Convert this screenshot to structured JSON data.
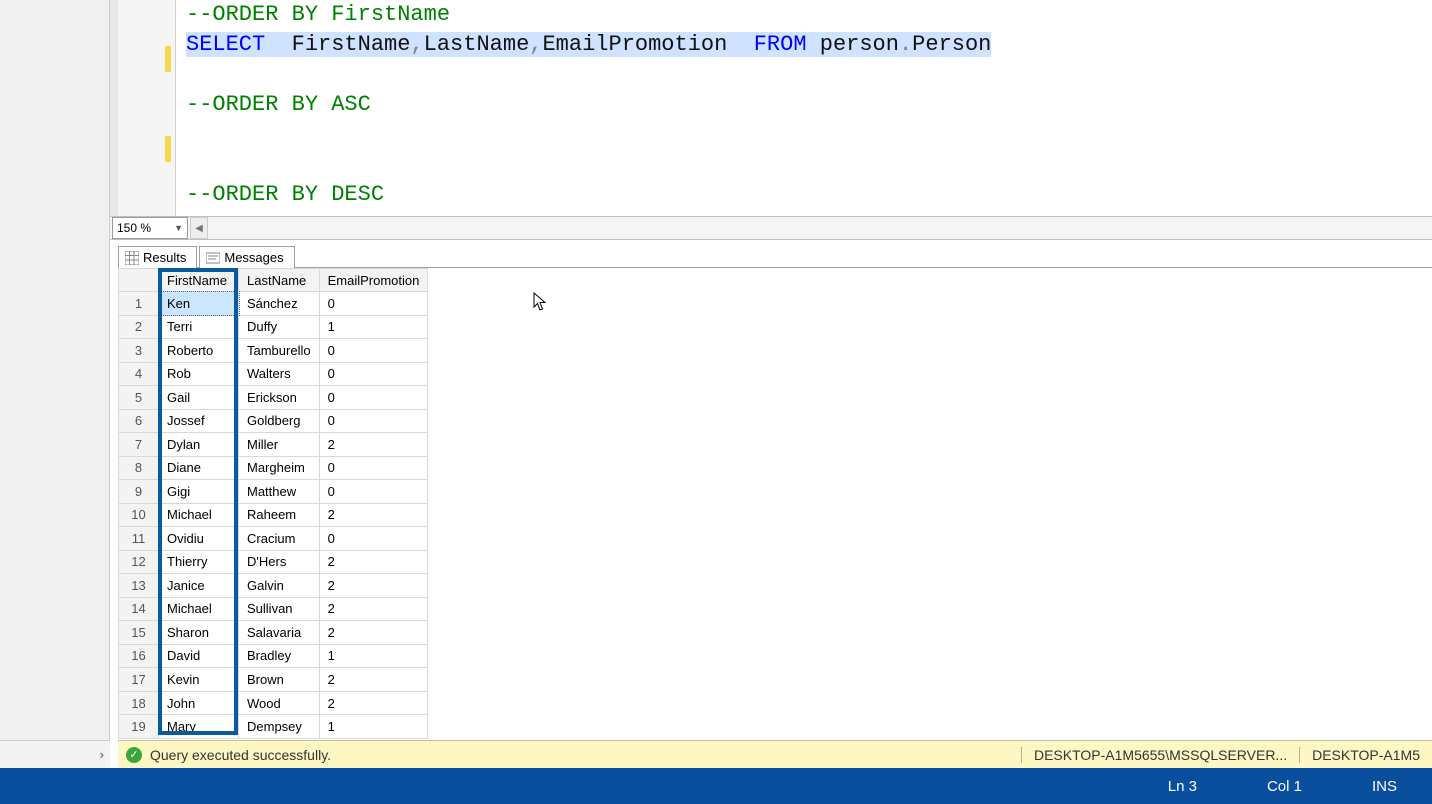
{
  "editor": {
    "comment1": "--ORDER BY FirstName",
    "kw_select": "SELECT",
    "cols": "FirstName,LastName,EmailPromotion",
    "col1": "FirstName",
    "col2": "LastName",
    "col3": "EmailPromotion",
    "kw_from": "FROM",
    "schema": "person",
    "dot": ".",
    "table": "Person",
    "comment2": "--ORDER BY ASC",
    "comment3": "--ORDER BY DESC"
  },
  "zoom": {
    "value": "150 %"
  },
  "tabs": {
    "results": "Results",
    "messages": "Messages"
  },
  "grid": {
    "headers": {
      "rownum": "",
      "c0": "FirstName",
      "c1": "LastName",
      "c2": "EmailPromotion"
    },
    "rows": [
      {
        "n": "1",
        "first": "Ken",
        "last": "Sánchez",
        "promo": "0"
      },
      {
        "n": "2",
        "first": "Terri",
        "last": "Duffy",
        "promo": "1"
      },
      {
        "n": "3",
        "first": "Roberto",
        "last": "Tamburello",
        "promo": "0"
      },
      {
        "n": "4",
        "first": "Rob",
        "last": "Walters",
        "promo": "0"
      },
      {
        "n": "5",
        "first": "Gail",
        "last": "Erickson",
        "promo": "0"
      },
      {
        "n": "6",
        "first": "Jossef",
        "last": "Goldberg",
        "promo": "0"
      },
      {
        "n": "7",
        "first": "Dylan",
        "last": "Miller",
        "promo": "2"
      },
      {
        "n": "8",
        "first": "Diane",
        "last": "Margheim",
        "promo": "0"
      },
      {
        "n": "9",
        "first": "Gigi",
        "last": "Matthew",
        "promo": "0"
      },
      {
        "n": "10",
        "first": "Michael",
        "last": "Raheem",
        "promo": "2"
      },
      {
        "n": "11",
        "first": "Ovidiu",
        "last": "Cracium",
        "promo": "0"
      },
      {
        "n": "12",
        "first": "Thierry",
        "last": "D'Hers",
        "promo": "2"
      },
      {
        "n": "13",
        "first": "Janice",
        "last": "Galvin",
        "promo": "2"
      },
      {
        "n": "14",
        "first": "Michael",
        "last": "Sullivan",
        "promo": "2"
      },
      {
        "n": "15",
        "first": "Sharon",
        "last": "Salavaria",
        "promo": "2"
      },
      {
        "n": "16",
        "first": "David",
        "last": "Bradley",
        "promo": "1"
      },
      {
        "n": "17",
        "first": "Kevin",
        "last": "Brown",
        "promo": "2"
      },
      {
        "n": "18",
        "first": "John",
        "last": "Wood",
        "promo": "2"
      },
      {
        "n": "19",
        "first": "Mary",
        "last": "Dempsey",
        "promo": "1"
      }
    ]
  },
  "status": {
    "message": "Query executed successfully.",
    "server": "DESKTOP-A1M5655\\MSSQLSERVER...",
    "user": "DESKTOP-A1M5"
  },
  "footer": {
    "ln": "Ln 3",
    "col": "Col 1",
    "ins": "INS"
  }
}
